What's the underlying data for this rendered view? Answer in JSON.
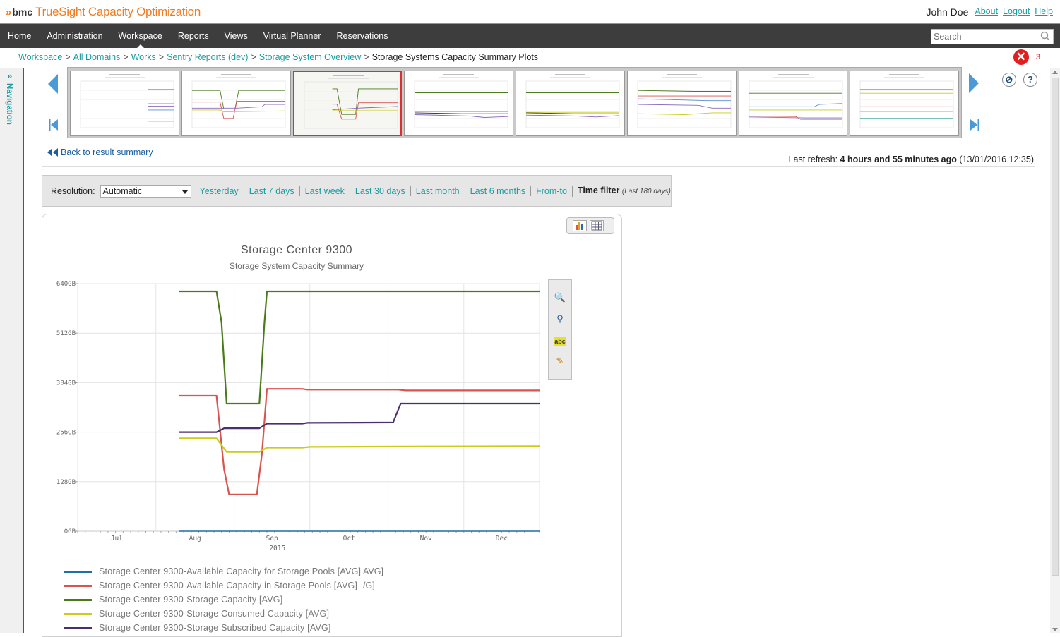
{
  "header": {
    "brand_mark": "bmc",
    "app_title": "TrueSight Capacity Optimization",
    "user_name": "John Doe",
    "links": [
      "About",
      "Logout",
      "Help"
    ]
  },
  "nav": {
    "items": [
      "Home",
      "Administration",
      "Workspace",
      "Reports",
      "Views",
      "Virtual Planner",
      "Reservations"
    ],
    "active": "Workspace",
    "search_placeholder": "Search"
  },
  "breadcrumb": {
    "crumbs": [
      "Workspace",
      "All Domains",
      "Works",
      "Sentry Reports (dev)",
      "Storage System Overview"
    ],
    "separator": ">",
    "current": "Storage Systems Capacity Summary Plots"
  },
  "errors": {
    "count": "3"
  },
  "left_nav": {
    "label": "Navigation",
    "toggle": "»"
  },
  "thumbnails": {
    "count": 8,
    "selected_index": 2
  },
  "back_link": "Back to result summary",
  "refresh": {
    "prefix": "Last refresh:",
    "age": "4 hours and 55 minutes ago",
    "timestamp": "(13/01/2016 12:35)"
  },
  "filter": {
    "resolution_label": "Resolution:",
    "resolution_value": "Automatic",
    "links": [
      "Yesterday",
      "Last 7 days",
      "Last week",
      "Last 30 days",
      "Last month",
      "Last 6 months",
      "From-to"
    ],
    "time_filter_label": "Time filter",
    "time_filter_sub": "(Last 180 days)"
  },
  "colors": {
    "accent": "#f07a1e",
    "link": "#1a9ba0",
    "nav_bg": "#3d3d3d",
    "error": "#e02020"
  },
  "chart_data": {
    "type": "line",
    "title": "Storage Center 9300",
    "subtitle": "Storage System Capacity Summary",
    "x_tick_labels": [
      "Jul",
      "Aug",
      "Sep",
      "Oct",
      "Nov",
      "Dec"
    ],
    "x_year_label": "2015",
    "y_tick_labels": [
      "0GB",
      "128GB",
      "256GB",
      "384GB",
      "512GB",
      "640GB"
    ],
    "ylim": [
      0,
      640
    ],
    "xlim": [
      "2015-07-01",
      "2015-12-31"
    ],
    "grid": true,
    "legend_position": "bottom",
    "series": [
      {
        "name": "Storage Center 9300-Available Capacity for Storage Pools [AVG]",
        "color": "#1f6fa8",
        "points": [
          [
            "2015-08-10",
            0
          ],
          [
            "2015-12-31",
            0
          ]
        ]
      },
      {
        "name": "Storage Center 9300-Available Capacity in Storage Pools [AVG]",
        "color": "#d9534f",
        "points": [
          [
            "2015-08-10",
            350
          ],
          [
            "2015-08-25",
            350
          ],
          [
            "2015-08-28",
            160
          ],
          [
            "2015-08-30",
            95
          ],
          [
            "2015-09-10",
            95
          ],
          [
            "2015-09-12",
            200
          ],
          [
            "2015-09-14",
            368
          ],
          [
            "2015-09-28",
            368
          ],
          [
            "2015-09-30",
            366
          ],
          [
            "2015-11-05",
            366
          ],
          [
            "2015-11-08",
            364
          ],
          [
            "2015-12-31",
            364
          ]
        ]
      },
      {
        "name": "Storage Center 9300-Storage Capacity [AVG]",
        "color": "#4a7a1a",
        "points": [
          [
            "2015-08-10",
            620
          ],
          [
            "2015-08-25",
            620
          ],
          [
            "2015-08-27",
            540
          ],
          [
            "2015-08-29",
            330
          ],
          [
            "2015-09-11",
            330
          ],
          [
            "2015-09-13",
            540
          ],
          [
            "2015-09-14",
            620
          ],
          [
            "2015-12-31",
            620
          ]
        ]
      },
      {
        "name": "Storage Center 9300-Storage Consumed Capacity [AVG]",
        "color": "#c9cc1a",
        "points": [
          [
            "2015-08-10",
            240
          ],
          [
            "2015-08-25",
            240
          ],
          [
            "2015-08-29",
            205
          ],
          [
            "2015-09-11",
            205
          ],
          [
            "2015-09-14",
            216
          ],
          [
            "2015-09-28",
            216
          ],
          [
            "2015-10-01",
            218
          ],
          [
            "2015-11-08",
            219
          ],
          [
            "2015-12-31",
            220
          ]
        ]
      },
      {
        "name": "Storage Center 9300-Storage Subscribed Capacity [AVG]",
        "color": "#4a2f6e",
        "points": [
          [
            "2015-08-10",
            256
          ],
          [
            "2015-08-25",
            256
          ],
          [
            "2015-08-28",
            266
          ],
          [
            "2015-09-11",
            266
          ],
          [
            "2015-09-14",
            278
          ],
          [
            "2015-09-28",
            278
          ],
          [
            "2015-09-30",
            280
          ],
          [
            "2015-11-03",
            281
          ],
          [
            "2015-11-06",
            330
          ],
          [
            "2015-12-31",
            330
          ]
        ]
      }
    ],
    "legend_overflow": [
      "AVG]",
      "/G]"
    ]
  }
}
